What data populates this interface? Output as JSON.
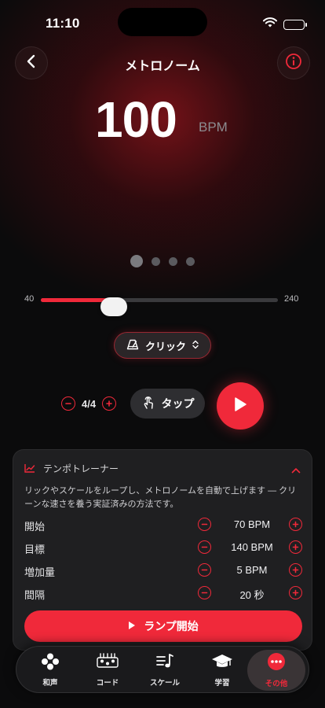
{
  "status_bar": {
    "time": "11:10"
  },
  "header": {
    "title": "メトロノーム"
  },
  "bpm": {
    "value": "100",
    "unit": "BPM"
  },
  "beat_dots": {
    "count": 4,
    "active_index": 0
  },
  "tempo_slider": {
    "min": "40",
    "max": "240",
    "value": 100
  },
  "sound": {
    "label": "クリック"
  },
  "time_signature": {
    "value": "4/4"
  },
  "tap": {
    "label": "タップ"
  },
  "trainer": {
    "title": "テンポトレーナー",
    "description": "リックやスケールをループし、メトロノームを自動で上げます — クリーンな速さを養う実証済みの方法です。",
    "rows": [
      {
        "label": "開始",
        "value": "70 BPM"
      },
      {
        "label": "目標",
        "value": "140 BPM"
      },
      {
        "label": "増加量",
        "value": "5 BPM"
      },
      {
        "label": "間隔",
        "value": "20 秒"
      }
    ],
    "start_button": "ランプ開始"
  },
  "nav": {
    "items": [
      {
        "label": "和声",
        "icon": "harmony-icon"
      },
      {
        "label": "コード",
        "icon": "chord-icon"
      },
      {
        "label": "スケール",
        "icon": "scale-icon"
      },
      {
        "label": "学習",
        "icon": "graduation-cap-icon"
      },
      {
        "label": "その他",
        "icon": "more-icon"
      }
    ],
    "active_index": 4
  },
  "colors": {
    "accent": "#f0293a",
    "background": "#0b0b0c",
    "card": "#1f1f21"
  }
}
